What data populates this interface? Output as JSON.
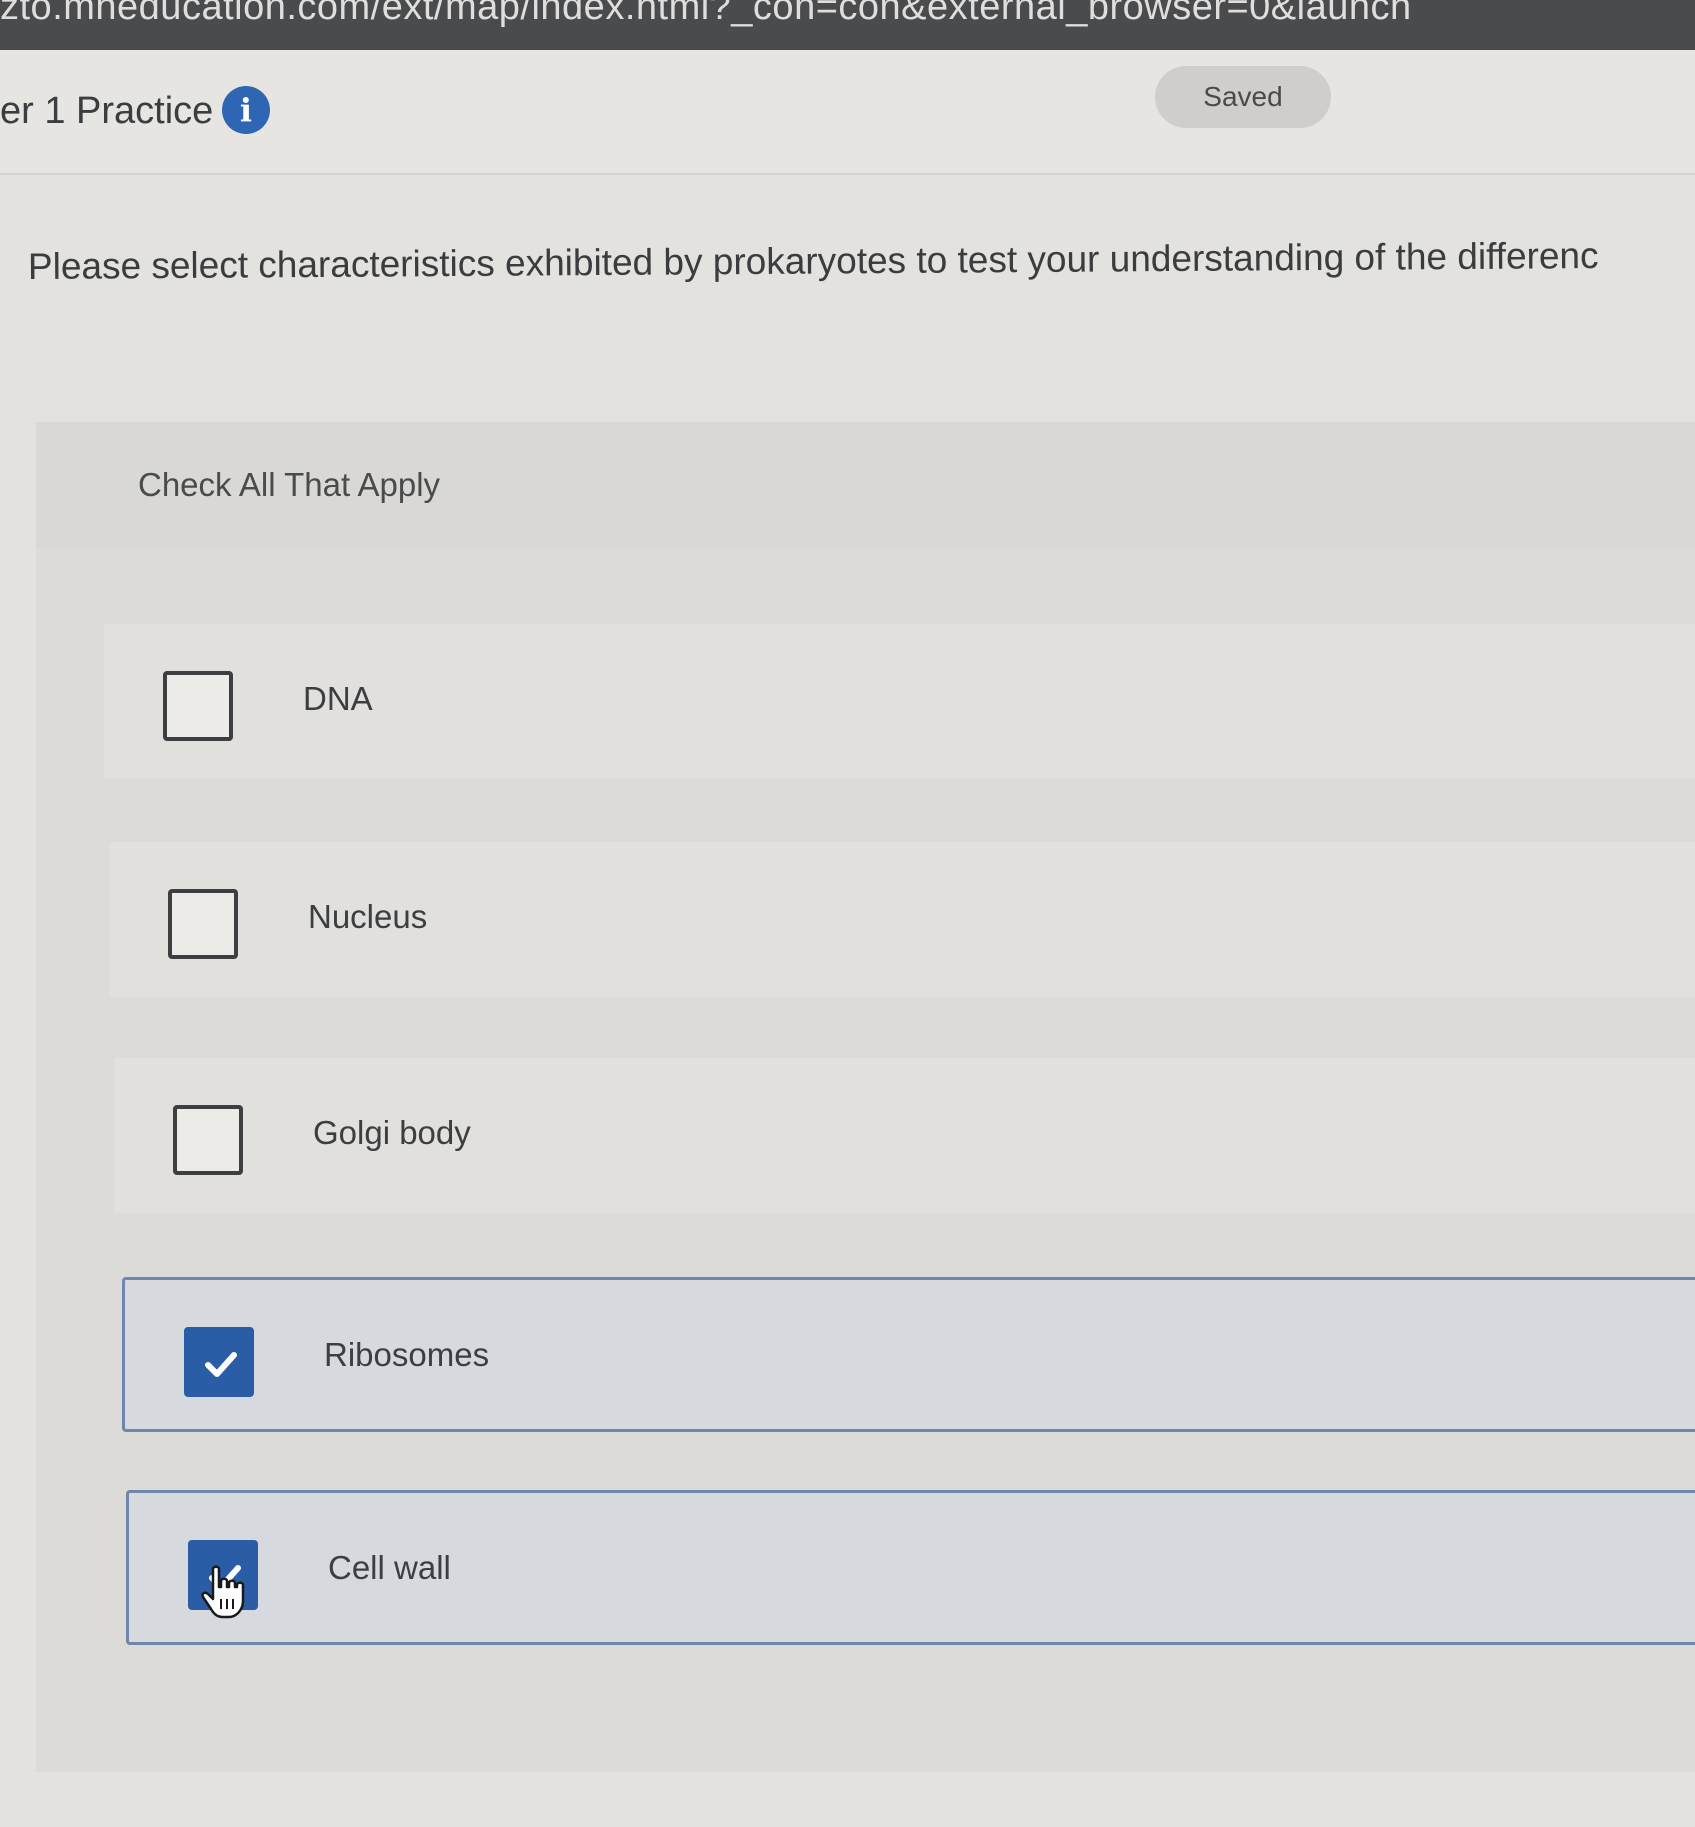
{
  "browser": {
    "url": "zto.mheducation.com/ext/map/index.html?_con=con&external_browser=0&launch"
  },
  "header": {
    "title": "er 1 Practice",
    "info_icon": "info-icon",
    "status": "Saved"
  },
  "question": {
    "prompt": "Please select characteristics exhibited by prokaryotes to test your understanding of the differenc",
    "instruction": "Check All That Apply",
    "options": [
      {
        "label": "DNA",
        "checked": false
      },
      {
        "label": "Nucleus",
        "checked": false
      },
      {
        "label": "Golgi body",
        "checked": false
      },
      {
        "label": "Ribosomes",
        "checked": true
      },
      {
        "label": "Cell wall",
        "checked": true
      }
    ]
  },
  "colors": {
    "accent": "#2b5ca6",
    "selected_border": "#6f86ad",
    "info_icon": "#2f66b3"
  }
}
